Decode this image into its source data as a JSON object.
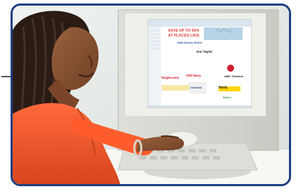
{
  "screen": {
    "headline_line1": "SAVE UP TO 50%",
    "headline_line2": "AT PLACES LIKE:",
    "logos": [
      "Walt Disney World",
      "Ann Taylor",
      "Target.com",
      "Old Navy",
      "Hertz",
      "Carnival",
      "AMC Theatres",
      "Dick's"
    ]
  },
  "colors": {
    "frame_border": "#1d3f82",
    "headline": "#e23d36",
    "skin": "#8b5634",
    "shirt": "#ef5a2f"
  }
}
